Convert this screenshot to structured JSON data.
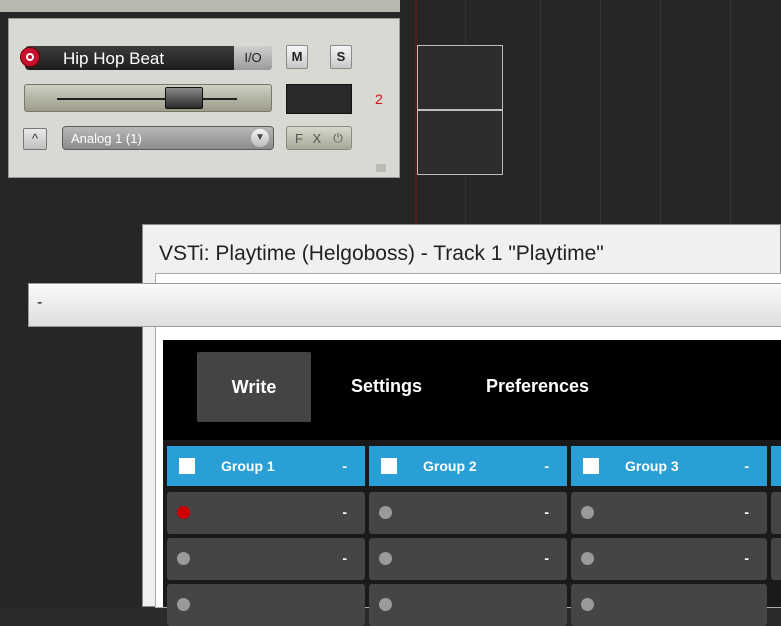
{
  "track": {
    "name": "Hip Hop Beat",
    "io_label": "I/O",
    "mute_label": "M",
    "solo_label": "S",
    "number": "2",
    "input": "Analog 1 (1)",
    "fx_label": "F X",
    "power_icon": "power-icon",
    "up_icon": "arrow-up-icon",
    "chevron_icon": "chevron-down-icon"
  },
  "plugin": {
    "title": "VSTi: Playtime (Helgoboss) - Track 1 \"Playtime\"",
    "preset": "-",
    "nav": {
      "write": "Write",
      "settings": "Settings",
      "preferences": "Preferences"
    },
    "groups": [
      {
        "label": "Group 1",
        "dash": "-"
      },
      {
        "label": "Group 2",
        "dash": "-"
      },
      {
        "label": "Group 3",
        "dash": "-"
      }
    ],
    "rows": [
      [
        "-",
        "-",
        "-"
      ],
      [
        "-",
        "-",
        "-"
      ],
      [
        "",
        "",
        ""
      ]
    ]
  },
  "colors": {
    "accent": "#2a9fd6",
    "record": "#c8102e",
    "track_number": "#d21414"
  }
}
